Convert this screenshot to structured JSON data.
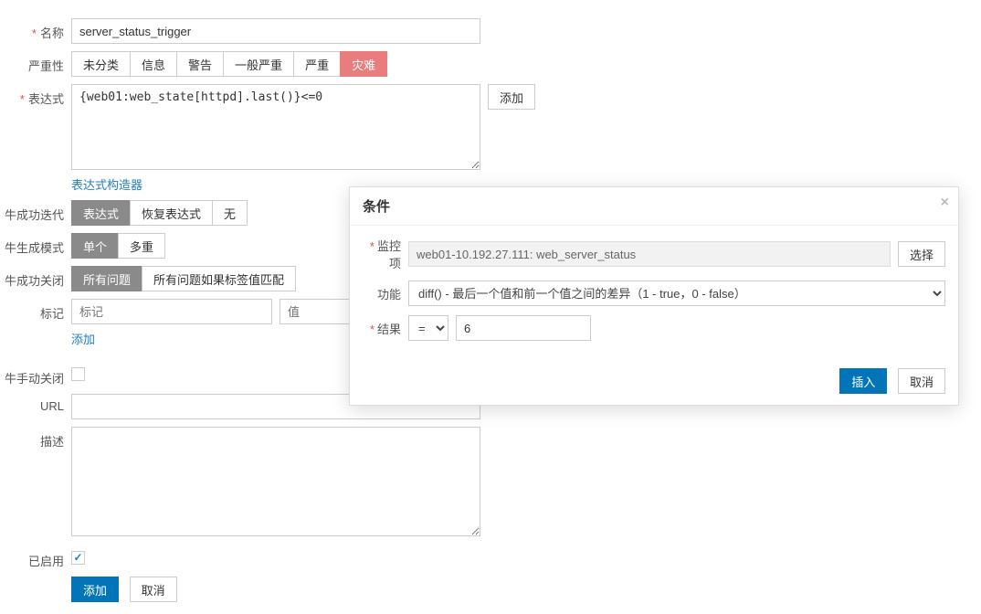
{
  "labels": {
    "name": "名称",
    "severity": "严重性",
    "expression": "表达式",
    "exprConstructor": "表达式构造器",
    "genIteration": "牛成功迭代",
    "genMode": "牛生成模式",
    "genClose": "牛成功关闭",
    "tag": "标记",
    "addLink": "添加",
    "manualClose": "牛手动关闭",
    "url": "URL",
    "description": "描述",
    "enabled": "已启用"
  },
  "name_value": "server_status_trigger",
  "severity_options": [
    "未分类",
    "信息",
    "警告",
    "一般严重",
    "严重",
    "灾难"
  ],
  "expression_value": "{web01:web_state[httpd].last()}<=0",
  "btn_add": "添加",
  "iteration_options": [
    "表达式",
    "恢复表达式",
    "无"
  ],
  "mode_options": [
    "单个",
    "多重"
  ],
  "close_options": [
    "所有问题",
    "所有问题如果标签值匹配"
  ],
  "tag_placeholder": "标记",
  "value_placeholder": "值",
  "btn_add_footer": "添加",
  "btn_cancel": "取消",
  "modal": {
    "title": "条件",
    "monitor_label": "监控项",
    "monitor_value": "web01-10.192.27.111: web_server_status",
    "select_btn": "选择",
    "func_label": "功能",
    "func_value": "diff() - 最后一个值和前一个值之间的差异（1 - true，0 - false）",
    "result_label": "结果",
    "operator": "=",
    "result_value": "6",
    "insert": "插入",
    "cancel": "取消"
  }
}
